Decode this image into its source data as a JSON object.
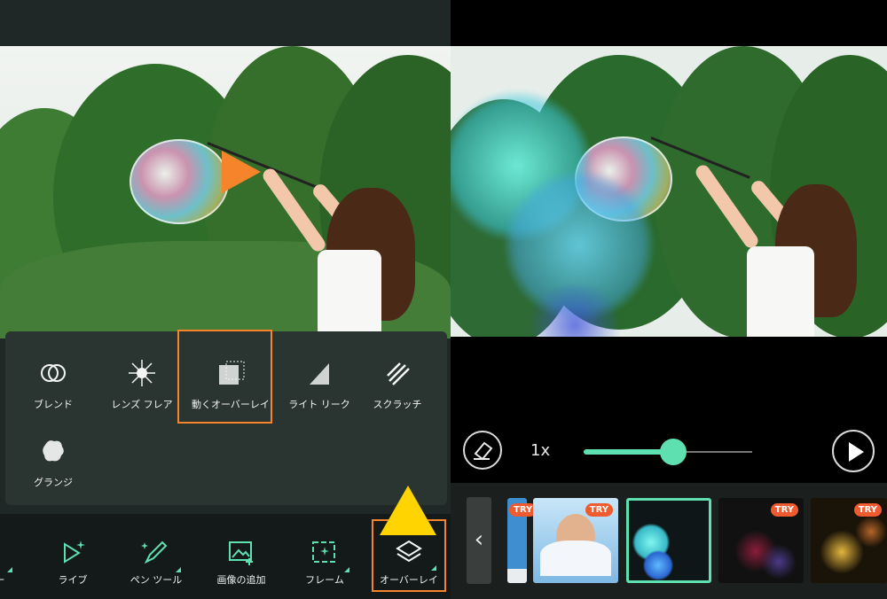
{
  "left_panel": {
    "overlay_menu": {
      "items": [
        {
          "label": "ブレンド",
          "icon": "blend-circles-icon"
        },
        {
          "label": "レンズ フレア",
          "icon": "lens-flare-icon"
        },
        {
          "label": "動くオーバーレイ",
          "icon": "animated-overlay-icon",
          "selected": true
        },
        {
          "label": "ライト リーク",
          "icon": "light-leak-icon"
        },
        {
          "label": "スクラッチ",
          "icon": "scratch-icon"
        },
        {
          "label": "グランジ",
          "icon": "grunge-icon"
        }
      ]
    },
    "toolbar": {
      "items": [
        {
          "label": "ー",
          "icon": "partial-tool-icon"
        },
        {
          "label": "ライブ",
          "icon": "live-sparkle-icon"
        },
        {
          "label": "ペン ツール",
          "icon": "pen-tool-icon"
        },
        {
          "label": "画像の追加",
          "icon": "add-image-icon"
        },
        {
          "label": "フレーム",
          "icon": "frame-icon"
        },
        {
          "label": "オーバーレイ",
          "icon": "overlay-layers-icon",
          "selected": true
        }
      ]
    },
    "annotation_colors": {
      "highlight": "#f5842b",
      "pointer": "#ffd400"
    }
  },
  "right_panel": {
    "speed_label": "1x",
    "slider_value": 0.53,
    "thumbnails": [
      {
        "kind": "partial",
        "try": "TRY"
      },
      {
        "kind": "angel-girl",
        "try": "TRY"
      },
      {
        "kind": "cyan-bokeh",
        "selected": true
      },
      {
        "kind": "red-bokeh",
        "try": "TRY"
      },
      {
        "kind": "gold-bokeh",
        "try": "TRY"
      }
    ],
    "back_label": "‹",
    "accent": "#5ee0b0"
  }
}
